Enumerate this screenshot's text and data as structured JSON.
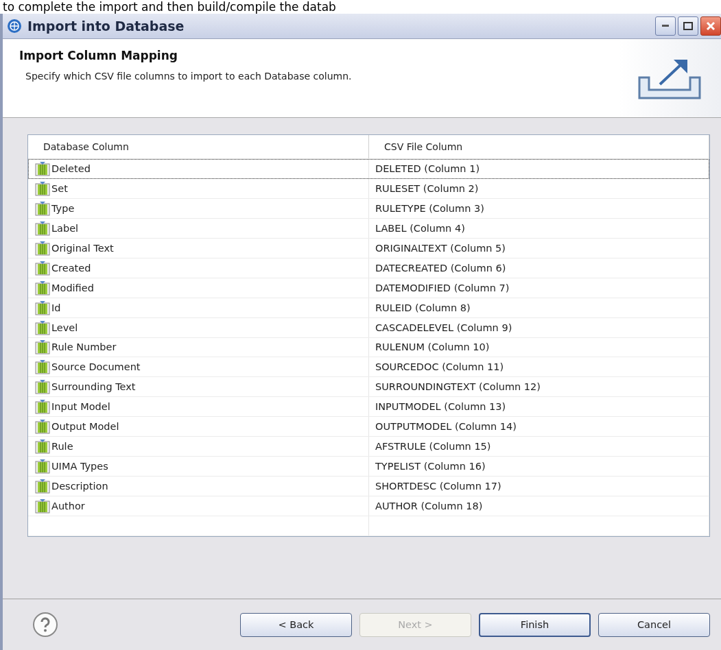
{
  "background_text": "to complete the import and then build/compile the datab",
  "window": {
    "title": "Import into Database"
  },
  "header": {
    "title": "Import Column Mapping",
    "description": "Specify which CSV file columns to import to each Database column."
  },
  "table": {
    "columns": [
      "Database Column",
      "CSV File Column"
    ],
    "rows": [
      {
        "database_column": "Deleted",
        "csv_column": "DELETED (Column 1)",
        "focused": true
      },
      {
        "database_column": "Set",
        "csv_column": "RULESET (Column 2)",
        "focused": false
      },
      {
        "database_column": "Type",
        "csv_column": "RULETYPE (Column 3)",
        "focused": false
      },
      {
        "database_column": "Label",
        "csv_column": "LABEL (Column 4)",
        "focused": false
      },
      {
        "database_column": "Original Text",
        "csv_column": "ORIGINALTEXT (Column 5)",
        "focused": false
      },
      {
        "database_column": "Created",
        "csv_column": "DATECREATED (Column 6)",
        "focused": false
      },
      {
        "database_column": "Modified",
        "csv_column": "DATEMODIFIED (Column 7)",
        "focused": false
      },
      {
        "database_column": "Id",
        "csv_column": "RULEID (Column 8)",
        "focused": false
      },
      {
        "database_column": "Level",
        "csv_column": "CASCADELEVEL (Column 9)",
        "focused": false
      },
      {
        "database_column": "Rule Number",
        "csv_column": "RULENUM (Column 10)",
        "focused": false
      },
      {
        "database_column": "Source Document",
        "csv_column": "SOURCEDOC (Column 11)",
        "focused": false
      },
      {
        "database_column": "Surrounding Text",
        "csv_column": "SURROUNDINGTEXT (Column 12)",
        "focused": false
      },
      {
        "database_column": "Input Model",
        "csv_column": "INPUTMODEL (Column 13)",
        "focused": false
      },
      {
        "database_column": "Output Model",
        "csv_column": "OUTPUTMODEL (Column 14)",
        "focused": false
      },
      {
        "database_column": "Rule",
        "csv_column": "AFSTRULE (Column 15)",
        "focused": false
      },
      {
        "database_column": "UIMA Types",
        "csv_column": "TYPELIST (Column 16)",
        "focused": false
      },
      {
        "database_column": "Description",
        "csv_column": "SHORTDESC (Column 17)",
        "focused": false
      },
      {
        "database_column": "Author",
        "csv_column": "AUTHOR (Column 18)",
        "focused": false
      }
    ]
  },
  "buttons": [
    {
      "label": "< Back",
      "disabled": false,
      "default": false
    },
    {
      "label": "Next >",
      "disabled": true,
      "default": false
    },
    {
      "label": "Finish",
      "disabled": false,
      "default": true
    },
    {
      "label": "Cancel",
      "disabled": false,
      "default": false
    }
  ]
}
